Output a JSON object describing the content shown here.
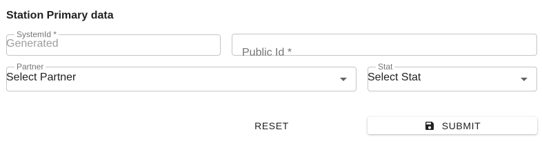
{
  "section": {
    "title": "Station Primary data"
  },
  "fields": {
    "system_id": {
      "label": "SystemId *",
      "value": "Generated"
    },
    "public_id": {
      "label": "Public Id *"
    },
    "partner": {
      "label": "Partner",
      "value": "Select Partner"
    },
    "stat": {
      "label": "Stat",
      "value": "Select Stat"
    }
  },
  "actions": {
    "reset_label": "RESET",
    "submit_label": "SUBMIT",
    "submit_icon": "save-icon"
  }
}
